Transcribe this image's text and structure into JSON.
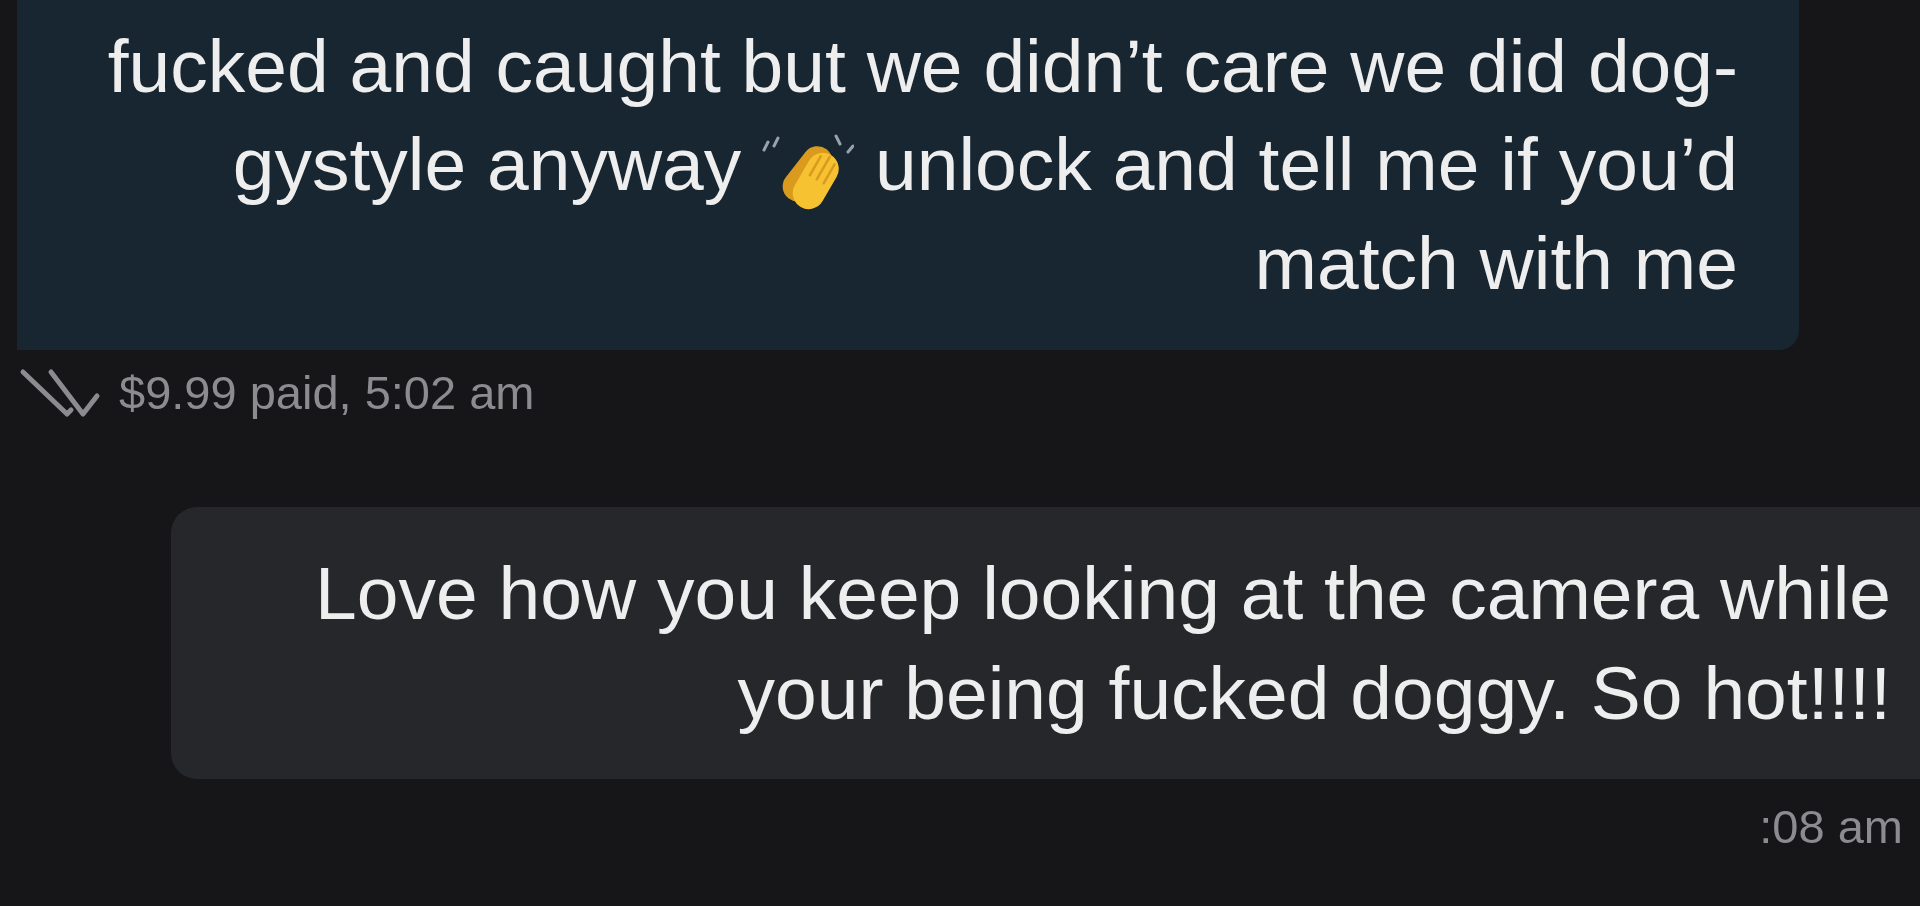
{
  "messages": [
    {
      "kind": "sent",
      "parts": [
        {
          "kind": "text",
          "text": "fucked and caught but we didn’t care we did dog-gystyle anyway"
        },
        {
          "kind": "emoji"
        },
        {
          "kind": "text",
          "text": "unlock and tell me if you’d match with me"
        }
      ],
      "footer": "$9.99 paid, 5:02 am",
      "read": true
    },
    {
      "kind": "received",
      "parts": [
        {
          "kind": "text",
          "text": "Love how you keep looking at the camera while your being fucked doggy. So hot!!!!"
        }
      ],
      "footer": ":08 am",
      "read": false
    }
  ]
}
